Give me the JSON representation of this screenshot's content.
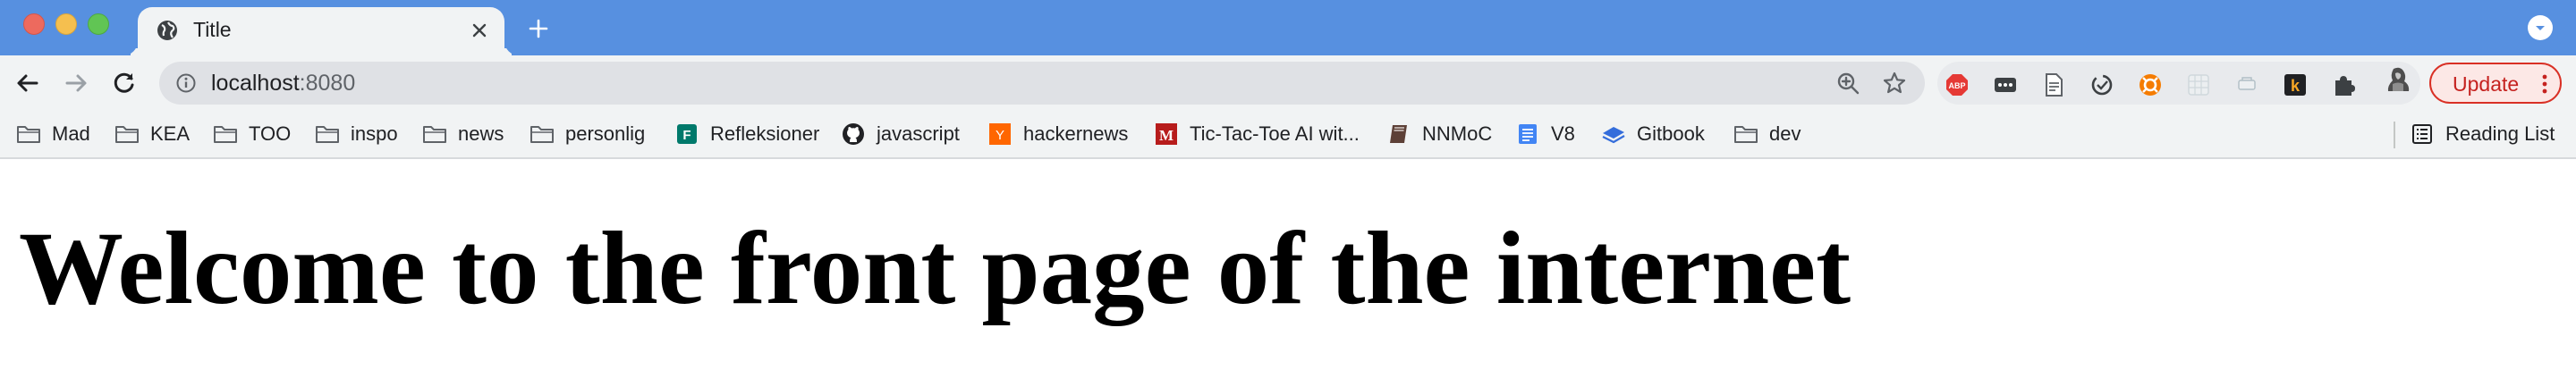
{
  "window": {
    "tab_title": "Title",
    "colors": {
      "tabstrip": "#5790e0",
      "toolbar": "#f1f3f4",
      "update_accent": "#d93025"
    }
  },
  "toolbar": {
    "url_host": "localhost",
    "url_port": ":8080",
    "update_label": "Update"
  },
  "bookmarks": [
    {
      "label": "Mad",
      "icon": "folder-icon"
    },
    {
      "label": "KEA",
      "icon": "folder-icon"
    },
    {
      "label": "TOO",
      "icon": "folder-icon"
    },
    {
      "label": "inspo",
      "icon": "folder-icon"
    },
    {
      "label": "news",
      "icon": "folder-icon"
    },
    {
      "label": "personlig",
      "icon": "folder-icon"
    },
    {
      "label": "Refleksioner",
      "icon": "forms-icon"
    },
    {
      "label": "javascript",
      "icon": "github-icon"
    },
    {
      "label": "hackernews",
      "icon": "ycombinator-icon"
    },
    {
      "label": "Tic-Tac-Toe AI wit...",
      "icon": "medium-icon"
    },
    {
      "label": "NNMoC",
      "icon": "book-icon"
    },
    {
      "label": "V8",
      "icon": "docs-icon"
    },
    {
      "label": "Gitbook",
      "icon": "gitbook-icon"
    },
    {
      "label": "dev",
      "icon": "folder-icon"
    }
  ],
  "reading_list": {
    "label": "Reading List"
  },
  "page": {
    "heading": "Welcome to the front page of the internet"
  }
}
